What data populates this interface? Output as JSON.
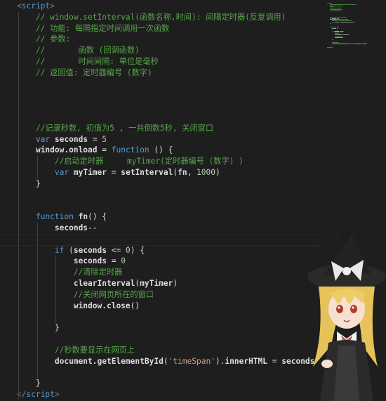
{
  "editor": {
    "lines": [
      [
        [
          "tag",
          "<"
        ],
        [
          "tagname",
          "script"
        ],
        [
          "tag",
          ">"
        ]
      ],
      [
        [
          "cm",
          "    // window.setInterval(函数名称,时间): 间隔定时器(反复调用)"
        ]
      ],
      [
        [
          "cm",
          "    // 功能: 每隔指定时间调用一次函数"
        ]
      ],
      [
        [
          "cm",
          "    // 参数:"
        ]
      ],
      [
        [
          "cm",
          "    //       函数 (回调函数)"
        ]
      ],
      [
        [
          "cm",
          "    //       时间间隔: 单位是毫秒"
        ]
      ],
      [
        [
          "cm",
          "    // 返回值: 定时器编号 (数字)"
        ]
      ],
      [],
      [],
      [],
      [],
      [
        [
          "cm",
          "    //记录秒数, 初值为5 , 一共倒数5秒, 关闭窗口"
        ]
      ],
      [
        [
          "pl",
          "    "
        ],
        [
          "kw",
          "var"
        ],
        [
          "pl",
          " "
        ],
        [
          "id",
          "seconds"
        ],
        [
          "pl",
          " = "
        ],
        [
          "num",
          "5"
        ]
      ],
      [
        [
          "pl",
          "    "
        ],
        [
          "prop",
          "window.onload"
        ],
        [
          "pl",
          " = "
        ],
        [
          "kw",
          "function"
        ],
        [
          "pl",
          " () {"
        ]
      ],
      [
        [
          "cm",
          "        //启动定时器     myTimer(定时器编号 (数字) )"
        ]
      ],
      [
        [
          "pl",
          "        "
        ],
        [
          "kw",
          "var"
        ],
        [
          "pl",
          " "
        ],
        [
          "id",
          "myTimer"
        ],
        [
          "pl",
          " = "
        ],
        [
          "fn",
          "setInterval"
        ],
        [
          "pl",
          "("
        ],
        [
          "id",
          "fn"
        ],
        [
          "pl",
          ", "
        ],
        [
          "num",
          "1000"
        ],
        [
          "pl",
          ")"
        ]
      ],
      [
        [
          "pl",
          "    }"
        ]
      ],
      [],
      [],
      [
        [
          "pl",
          "    "
        ],
        [
          "kw",
          "function"
        ],
        [
          "pl",
          " "
        ],
        [
          "fn",
          "fn"
        ],
        [
          "pl",
          "() "
        ],
        [
          "pl",
          "{"
        ]
      ],
      [
        [
          "pl",
          "        "
        ],
        [
          "id",
          "seconds"
        ],
        [
          "pl",
          "--"
        ]
      ],
      [],
      [
        [
          "pl",
          "        "
        ],
        [
          "kw",
          "if"
        ],
        [
          "pl",
          " ("
        ],
        [
          "id",
          "seconds"
        ],
        [
          "pl",
          " <= "
        ],
        [
          "num",
          "0"
        ],
        [
          "pl",
          ") {"
        ]
      ],
      [
        [
          "pl",
          "            "
        ],
        [
          "id",
          "seconds"
        ],
        [
          "pl",
          " = "
        ],
        [
          "num",
          "0"
        ]
      ],
      [
        [
          "cm",
          "            //清除定时器"
        ]
      ],
      [
        [
          "pl",
          "            "
        ],
        [
          "fn",
          "clearInterval"
        ],
        [
          "pl",
          "("
        ],
        [
          "id",
          "myTimer"
        ],
        [
          "pl",
          ")"
        ]
      ],
      [
        [
          "cm",
          "            //关闭网页所在的窗口"
        ]
      ],
      [
        [
          "pl",
          "            "
        ],
        [
          "prop",
          "window.close"
        ],
        [
          "pl",
          "()"
        ]
      ],
      [],
      [
        [
          "pl",
          "        }"
        ]
      ],
      [],
      [
        [
          "cm",
          "        //秒数要显示在网页上"
        ]
      ],
      [
        [
          "pl",
          "        "
        ],
        [
          "prop",
          "document.getElementById"
        ],
        [
          "pl",
          "("
        ],
        [
          "str",
          "'timeSpan'"
        ],
        [
          "pl",
          ")."
        ],
        [
          "prop",
          "innerHTML"
        ],
        [
          "pl",
          " = "
        ],
        [
          "id",
          "seconds"
        ]
      ],
      [],
      [
        [
          "pl",
          "    }"
        ]
      ],
      [
        [
          "tag",
          "</"
        ],
        [
          "tagname",
          "script"
        ],
        [
          "tag",
          ">"
        ]
      ]
    ]
  },
  "colors": {
    "background": "#1e1e1e",
    "comment": "#57a64a",
    "keyword": "#569cd6",
    "number": "#b5cea8",
    "string": "#d69d85"
  }
}
